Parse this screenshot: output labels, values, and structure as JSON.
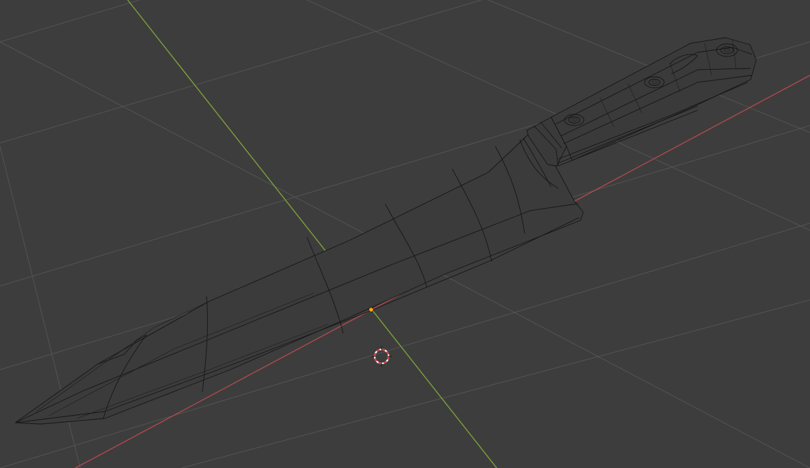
{
  "app": {
    "editor": "3D Viewport",
    "shading": "wireframe"
  },
  "scene": {
    "object": "knife",
    "object_parts": [
      "blade",
      "bolster",
      "handle",
      "rivets"
    ],
    "rivet_count": 3,
    "grid_visible": true,
    "axes_visible": [
      "x",
      "y"
    ]
  },
  "colors": {
    "background": "#3d3d3d",
    "grid": "#545454",
    "wire": "#151515",
    "x_axis": "#b84a4f",
    "y_axis": "#7da23a",
    "origin": "#ffaa1a",
    "cursor_red": "#d83c3c",
    "cursor_white": "#ffffff"
  },
  "icons": {
    "origin": "object-origin-dot-icon",
    "cursor": "3d-cursor-icon"
  }
}
